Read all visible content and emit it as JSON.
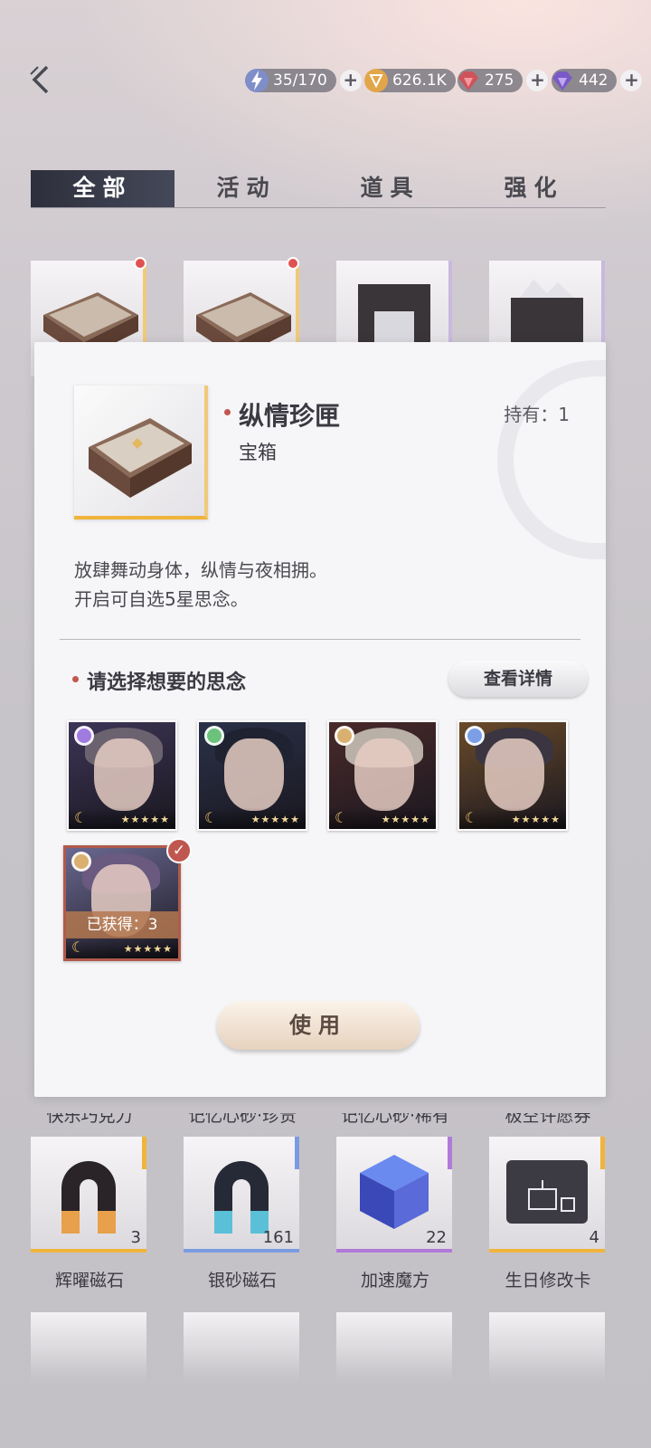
{
  "header": {
    "currencies": [
      {
        "name": "stamina",
        "icon": "lightning-icon",
        "value": "35/170",
        "color": "#8a9bd8"
      },
      {
        "name": "gold",
        "icon": "coin-icon",
        "value": "626.1K",
        "color": "#e0a84a"
      },
      {
        "name": "red-diamond",
        "icon": "red-gem-icon",
        "value": "275",
        "color": "#d0525a"
      },
      {
        "name": "purple-diamond",
        "icon": "purple-gem-icon",
        "value": "442",
        "color": "#8a6ad0"
      }
    ],
    "plus_label": "+"
  },
  "tabs": [
    {
      "label": "全部",
      "active": true
    },
    {
      "label": "活动",
      "active": false
    },
    {
      "label": "道具",
      "active": false
    },
    {
      "label": "强化",
      "active": false
    }
  ],
  "detail": {
    "title": "纵情珍匣",
    "type": "宝箱",
    "held": "持有：1",
    "description_line1": "放肆舞动身体，纵情与夜相拥。",
    "description_line2": "开启可自选5星思念。",
    "select_label": "请选择想要的思念",
    "view_details_button": "查看详情",
    "owned_tag": "已获得：3",
    "use_button": "使用",
    "choices": [
      {
        "orb": "#a07be0",
        "hair": "#6b6270",
        "bg": "#3d3556",
        "rating": "★★★★★"
      },
      {
        "orb": "#6cc27a",
        "hair": "#1f2230",
        "bg": "#2a3148",
        "rating": "★★★★★"
      },
      {
        "orb": "#d9b070",
        "hair": "#b9b0a8",
        "bg": "#4a2a2a",
        "rating": "★★★★★"
      },
      {
        "orb": "#7c9ee6",
        "hair": "#3a3540",
        "bg": "#6a4a2a",
        "rating": "★★★★★"
      },
      {
        "orb": "#d9b070",
        "hair": "#6a5a80",
        "bg": "#6a6890",
        "rating": "★★★★★"
      }
    ]
  },
  "inventory": {
    "cut_labels": [
      "快乐巧克力",
      "记忆心砂·珍贵",
      "记忆心砂·稀有",
      "极空许愿券"
    ],
    "items": [
      {
        "label": "辉曜磁石",
        "count": "3",
        "accent": "#f0b43c"
      },
      {
        "label": "银砂磁石",
        "count": "161",
        "accent": "#7a9be0"
      },
      {
        "label": "加速魔方",
        "count": "22",
        "accent": "#b07ad8"
      },
      {
        "label": "生日修改卡",
        "count": "4",
        "accent": "#f0b43c"
      }
    ]
  }
}
